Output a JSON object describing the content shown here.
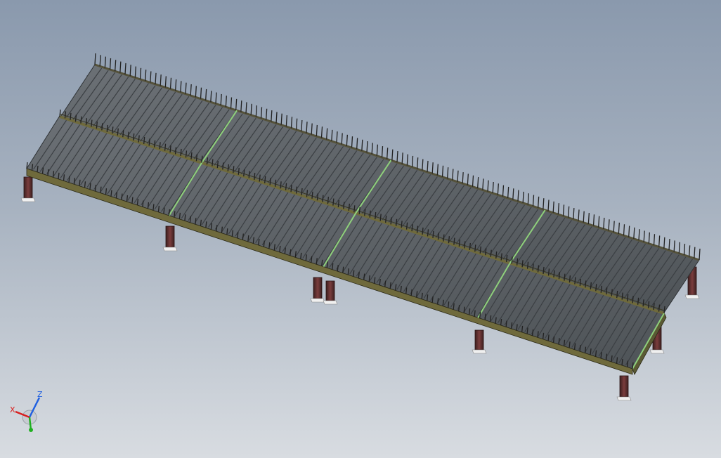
{
  "viewport": {
    "background_top": "#8a99ad",
    "background_bottom": "#d8dce1"
  },
  "model": {
    "type": "isometric steel platform / conveyor deck",
    "colors": {
      "deck": "#5f6469",
      "deck_dark": "#3f4347",
      "edge_beam": "#6f6a3c",
      "splice": "#8fd07c",
      "leg": "#5a2e2e",
      "foot": "#f0f0f0",
      "spike": "#2a2a2a"
    }
  },
  "triad": {
    "x_label": "X",
    "z_label": "Z",
    "x_color": "#d82020",
    "y_color": "#20b020",
    "z_color": "#2060e0",
    "icon": "coordinate-triad-icon"
  }
}
